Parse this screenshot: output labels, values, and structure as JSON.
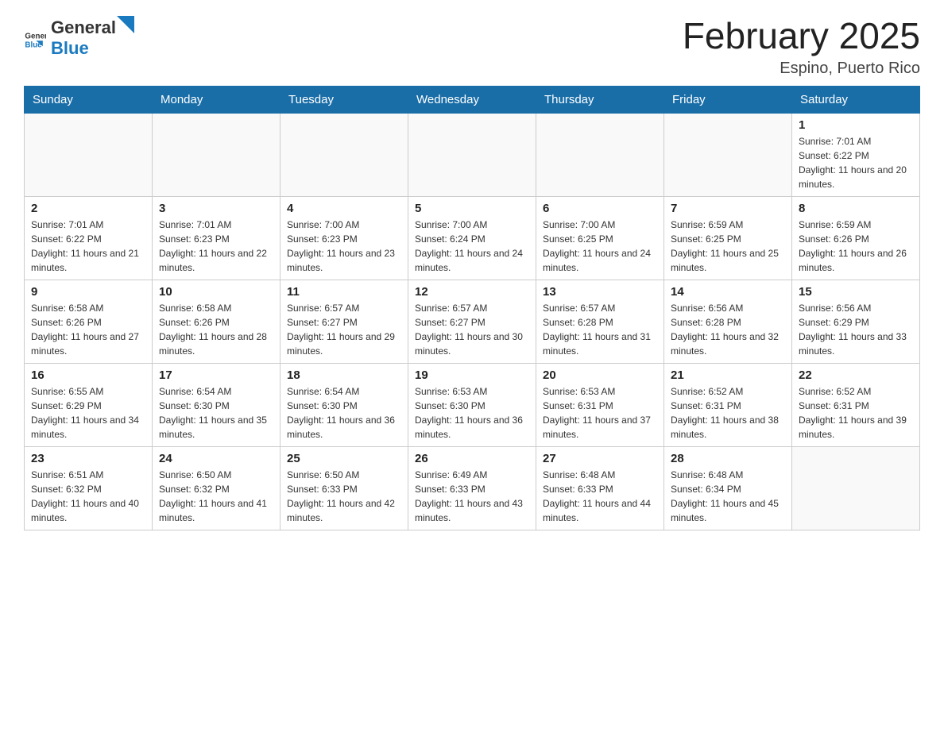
{
  "header": {
    "logo_general": "General",
    "logo_blue": "Blue",
    "title": "February 2025",
    "subtitle": "Espino, Puerto Rico"
  },
  "days_of_week": [
    "Sunday",
    "Monday",
    "Tuesday",
    "Wednesday",
    "Thursday",
    "Friday",
    "Saturday"
  ],
  "weeks": [
    [
      {
        "day": "",
        "info": ""
      },
      {
        "day": "",
        "info": ""
      },
      {
        "day": "",
        "info": ""
      },
      {
        "day": "",
        "info": ""
      },
      {
        "day": "",
        "info": ""
      },
      {
        "day": "",
        "info": ""
      },
      {
        "day": "1",
        "info": "Sunrise: 7:01 AM\nSunset: 6:22 PM\nDaylight: 11 hours and 20 minutes."
      }
    ],
    [
      {
        "day": "2",
        "info": "Sunrise: 7:01 AM\nSunset: 6:22 PM\nDaylight: 11 hours and 21 minutes."
      },
      {
        "day": "3",
        "info": "Sunrise: 7:01 AM\nSunset: 6:23 PM\nDaylight: 11 hours and 22 minutes."
      },
      {
        "day": "4",
        "info": "Sunrise: 7:00 AM\nSunset: 6:23 PM\nDaylight: 11 hours and 23 minutes."
      },
      {
        "day": "5",
        "info": "Sunrise: 7:00 AM\nSunset: 6:24 PM\nDaylight: 11 hours and 24 minutes."
      },
      {
        "day": "6",
        "info": "Sunrise: 7:00 AM\nSunset: 6:25 PM\nDaylight: 11 hours and 24 minutes."
      },
      {
        "day": "7",
        "info": "Sunrise: 6:59 AM\nSunset: 6:25 PM\nDaylight: 11 hours and 25 minutes."
      },
      {
        "day": "8",
        "info": "Sunrise: 6:59 AM\nSunset: 6:26 PM\nDaylight: 11 hours and 26 minutes."
      }
    ],
    [
      {
        "day": "9",
        "info": "Sunrise: 6:58 AM\nSunset: 6:26 PM\nDaylight: 11 hours and 27 minutes."
      },
      {
        "day": "10",
        "info": "Sunrise: 6:58 AM\nSunset: 6:26 PM\nDaylight: 11 hours and 28 minutes."
      },
      {
        "day": "11",
        "info": "Sunrise: 6:57 AM\nSunset: 6:27 PM\nDaylight: 11 hours and 29 minutes."
      },
      {
        "day": "12",
        "info": "Sunrise: 6:57 AM\nSunset: 6:27 PM\nDaylight: 11 hours and 30 minutes."
      },
      {
        "day": "13",
        "info": "Sunrise: 6:57 AM\nSunset: 6:28 PM\nDaylight: 11 hours and 31 minutes."
      },
      {
        "day": "14",
        "info": "Sunrise: 6:56 AM\nSunset: 6:28 PM\nDaylight: 11 hours and 32 minutes."
      },
      {
        "day": "15",
        "info": "Sunrise: 6:56 AM\nSunset: 6:29 PM\nDaylight: 11 hours and 33 minutes."
      }
    ],
    [
      {
        "day": "16",
        "info": "Sunrise: 6:55 AM\nSunset: 6:29 PM\nDaylight: 11 hours and 34 minutes."
      },
      {
        "day": "17",
        "info": "Sunrise: 6:54 AM\nSunset: 6:30 PM\nDaylight: 11 hours and 35 minutes."
      },
      {
        "day": "18",
        "info": "Sunrise: 6:54 AM\nSunset: 6:30 PM\nDaylight: 11 hours and 36 minutes."
      },
      {
        "day": "19",
        "info": "Sunrise: 6:53 AM\nSunset: 6:30 PM\nDaylight: 11 hours and 36 minutes."
      },
      {
        "day": "20",
        "info": "Sunrise: 6:53 AM\nSunset: 6:31 PM\nDaylight: 11 hours and 37 minutes."
      },
      {
        "day": "21",
        "info": "Sunrise: 6:52 AM\nSunset: 6:31 PM\nDaylight: 11 hours and 38 minutes."
      },
      {
        "day": "22",
        "info": "Sunrise: 6:52 AM\nSunset: 6:31 PM\nDaylight: 11 hours and 39 minutes."
      }
    ],
    [
      {
        "day": "23",
        "info": "Sunrise: 6:51 AM\nSunset: 6:32 PM\nDaylight: 11 hours and 40 minutes."
      },
      {
        "day": "24",
        "info": "Sunrise: 6:50 AM\nSunset: 6:32 PM\nDaylight: 11 hours and 41 minutes."
      },
      {
        "day": "25",
        "info": "Sunrise: 6:50 AM\nSunset: 6:33 PM\nDaylight: 11 hours and 42 minutes."
      },
      {
        "day": "26",
        "info": "Sunrise: 6:49 AM\nSunset: 6:33 PM\nDaylight: 11 hours and 43 minutes."
      },
      {
        "day": "27",
        "info": "Sunrise: 6:48 AM\nSunset: 6:33 PM\nDaylight: 11 hours and 44 minutes."
      },
      {
        "day": "28",
        "info": "Sunrise: 6:48 AM\nSunset: 6:34 PM\nDaylight: 11 hours and 45 minutes."
      },
      {
        "day": "",
        "info": ""
      }
    ]
  ]
}
